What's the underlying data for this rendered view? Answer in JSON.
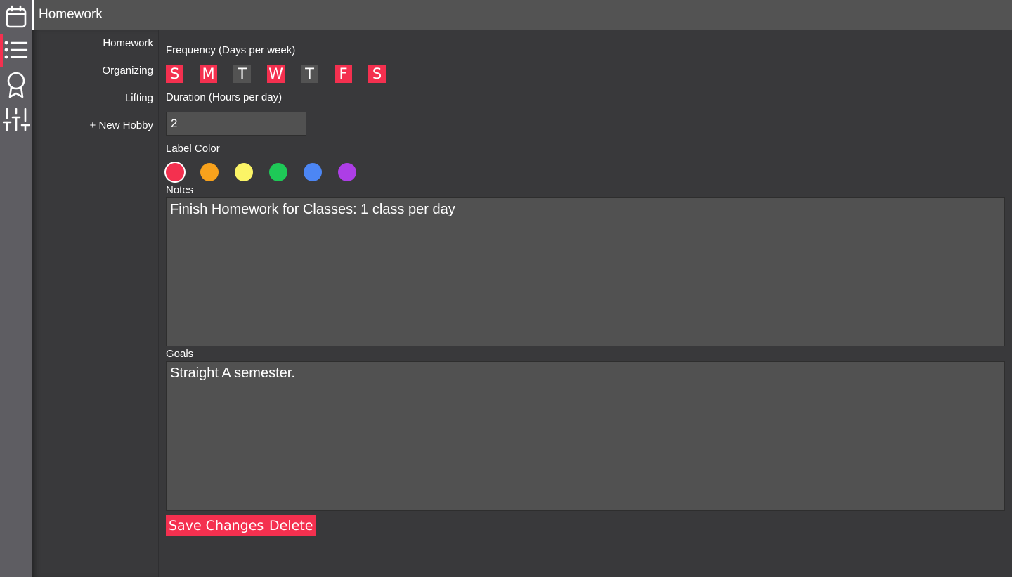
{
  "header": {
    "title": "Homework"
  },
  "rail": {
    "items": [
      {
        "icon": "calendar-icon"
      },
      {
        "icon": "list-icon",
        "active": true
      },
      {
        "icon": "award-icon"
      },
      {
        "icon": "sliders-icon"
      }
    ]
  },
  "hobbies": {
    "items": [
      "Homework",
      "Organizing",
      "Lifting"
    ],
    "new_label": "+ New Hobby"
  },
  "form": {
    "frequency_label": "Frequency (Days per week)",
    "days": [
      {
        "letter": "S",
        "selected": true
      },
      {
        "letter": "M",
        "selected": true
      },
      {
        "letter": "T",
        "selected": false
      },
      {
        "letter": "W",
        "selected": true
      },
      {
        "letter": "T",
        "selected": false
      },
      {
        "letter": "F",
        "selected": true
      },
      {
        "letter": "S",
        "selected": true
      }
    ],
    "duration_label": "Duration (Hours per day)",
    "duration_value": "2",
    "color_label": "Label Color",
    "colors": [
      "#f4304f",
      "#f8a21c",
      "#fbf466",
      "#1ec957",
      "#4c86f4",
      "#ad3ee6"
    ],
    "selected_color": "#f4304f",
    "notes_label": "Notes",
    "notes_value": "Finish Homework for Classes: 1 class per day",
    "goals_label": "Goals",
    "goals_value": "Straight A semester.",
    "save_label": "Save Changes",
    "delete_label": "Delete"
  },
  "colors": {
    "accent": "#f4304f",
    "rail_bg": "#5e5d62",
    "topbar_bg": "#535353",
    "page_bg": "#39393b"
  }
}
